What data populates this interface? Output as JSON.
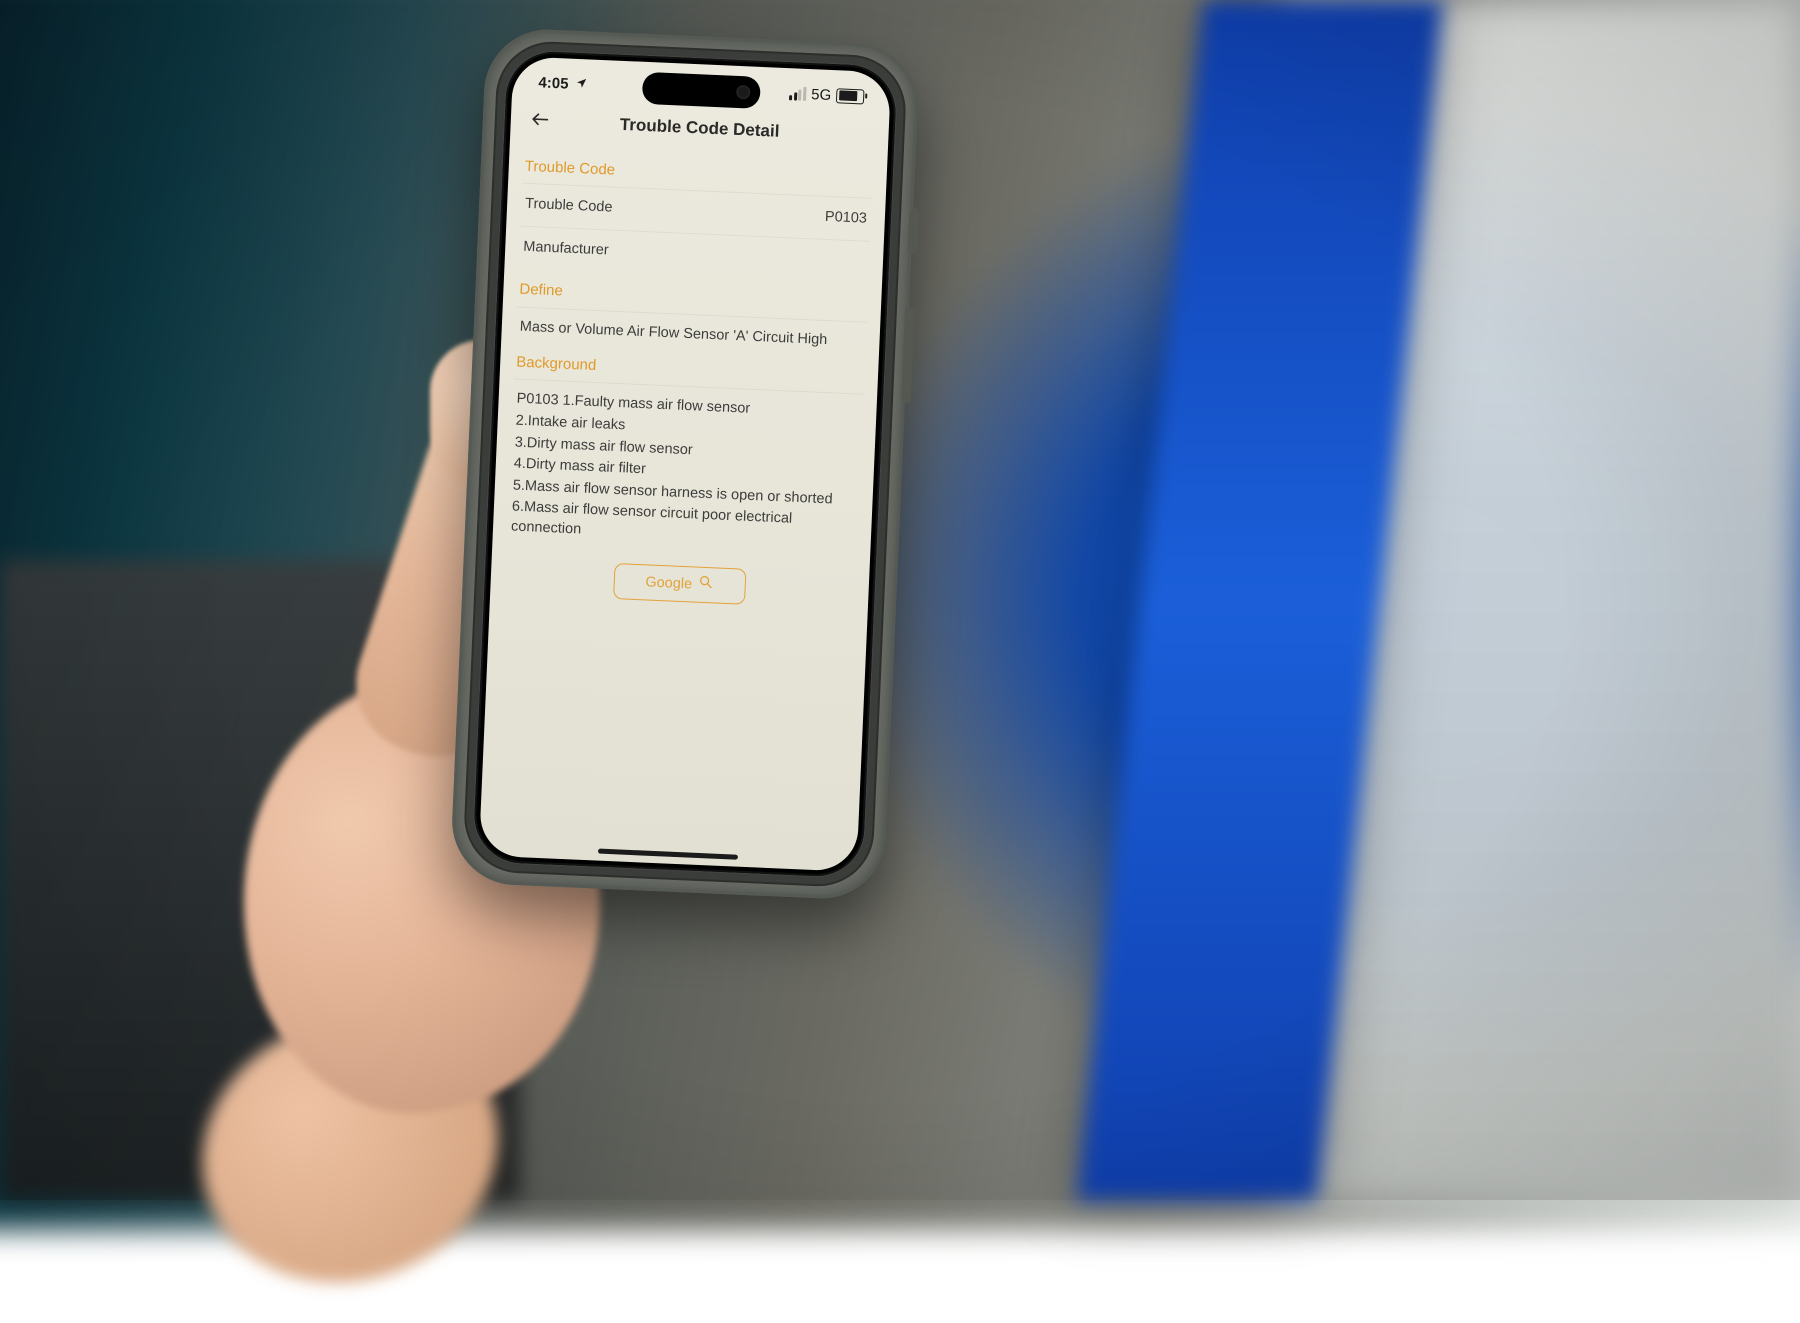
{
  "status": {
    "time": "4:05",
    "network": "5G"
  },
  "nav": {
    "title": "Trouble Code Detail"
  },
  "sections": {
    "trouble_code_h": "Trouble Code",
    "code_label": "Trouble Code",
    "code_value": "P0103",
    "manufacturer_label": "Manufacturer",
    "manufacturer_value": "",
    "define_h": "Define",
    "define_text": "Mass or Volume Air Flow Sensor 'A' Circuit High",
    "background_h": "Background",
    "background_lines": {
      "l1": "P0103 1.Faulty mass air flow sensor",
      "l2": "2.Intake air leaks",
      "l3": "3.Dirty mass air flow sensor",
      "l4": "4.Dirty mass air filter",
      "l5": "5.Mass air flow sensor harness is open or shorted",
      "l6": "6.Mass air flow sensor circuit poor electrical connection"
    }
  },
  "button": {
    "google": "Google"
  }
}
